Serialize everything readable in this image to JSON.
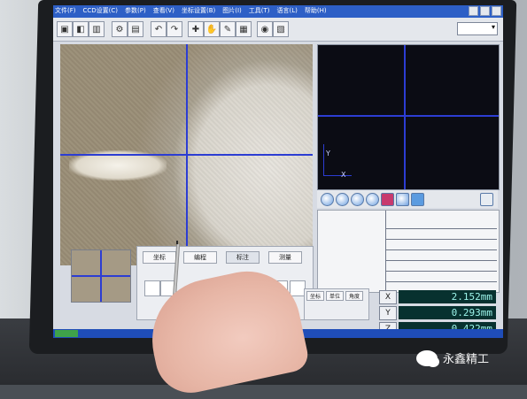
{
  "window": {
    "menus": [
      "文件(F)",
      "CCD设置(C)",
      "参数(P)",
      "查看(V)",
      "坐标设置(B)",
      "图片(I)",
      "工具(T)",
      "语言(L)",
      "帮助(H)"
    ]
  },
  "tabs": [
    "坐标",
    "编程",
    "标注",
    "测量"
  ],
  "bottom_panel": [
    "坐标",
    "单位",
    "角度"
  ],
  "readout": {
    "rows": [
      {
        "axis": "X",
        "value": "2.152mm"
      },
      {
        "axis": "Y",
        "value": "0.293mm"
      },
      {
        "axis": "Z",
        "value": "0.422mm"
      }
    ]
  },
  "graph": {
    "x_label": "X",
    "y_label": "Y"
  },
  "watermark": {
    "text": "永鑫精工"
  },
  "colors": {
    "crosshair": "#2c3dd3",
    "readout_bg": "#07312f",
    "readout_text": "#9df4ea",
    "menubar": "#2d5fc6"
  }
}
